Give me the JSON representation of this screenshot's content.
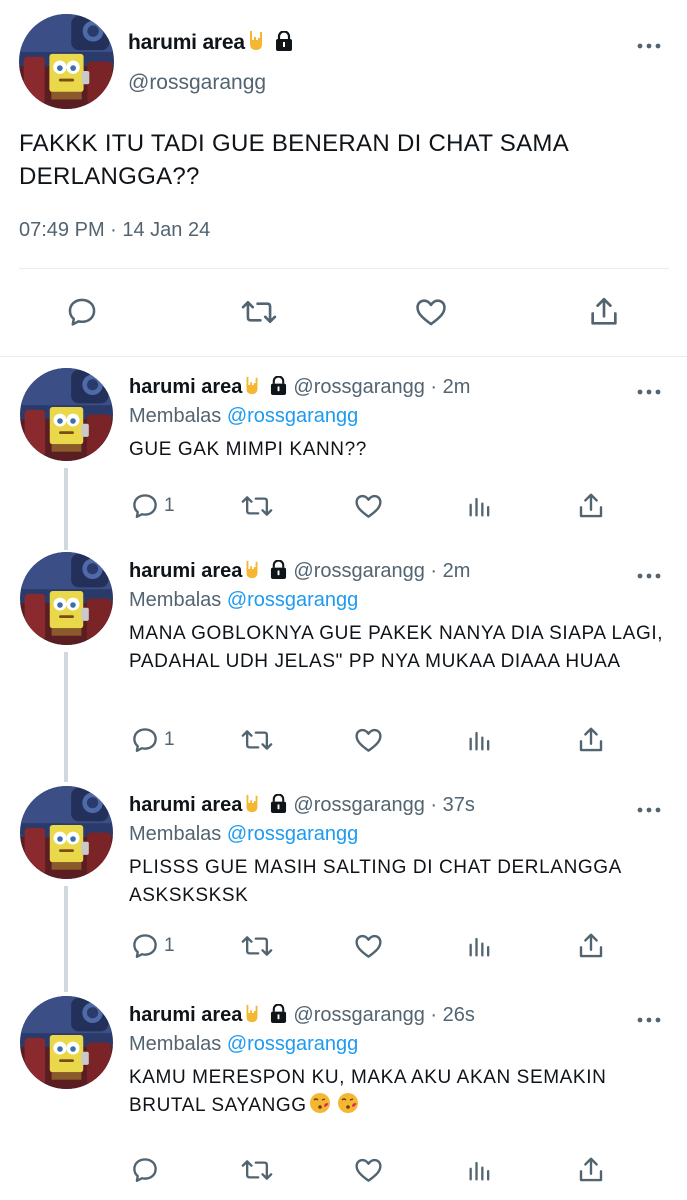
{
  "main_tweet": {
    "name": "harumi area",
    "name_emoji": "🤟",
    "handle": "@rossgarangg",
    "text": "FAKKK ITU TADI GUE BENERAN DI CHAT SAMA DERLANGGA??",
    "timestamp": "07:49 PM · 14 Jan 24",
    "actions": [
      "reply-icon",
      "retweet-icon",
      "like-icon",
      "share-icon"
    ]
  },
  "replies": [
    {
      "name": "harumi area",
      "handle": "@rossgarangg",
      "dot": " · ",
      "time": "2m",
      "replying_prefix": "Membalas ",
      "replying_to": "@rossgarangg",
      "text": "GUE GAK MIMPI KANN??",
      "reply_count": "1"
    },
    {
      "name": "harumi area",
      "handle": "@rossgarangg",
      "dot": " · ",
      "time": "2m",
      "replying_prefix": "Membalas ",
      "replying_to": "@rossgarangg",
      "text": "MANA GOBLOKNYA GUE PAKEK NANYA DIA SIAPA LAGI, PADAHAL UDH JELAS\" PP NYA MUKAA DIAAA HUAA",
      "reply_count": "1"
    },
    {
      "name": "harumi area",
      "handle": "@rossgarangg",
      "dot": " · ",
      "time": "37s",
      "replying_prefix": "Membalas ",
      "replying_to": "@rossgarangg",
      "text": "PLISSS GUE MASIH SALTING DI CHAT DERLANGGA ASKSKSKSK",
      "reply_count": "1"
    },
    {
      "name": "harumi area",
      "handle": "@rossgarangg",
      "dot": " · ",
      "time": "26s",
      "replying_prefix": "Membalas ",
      "replying_to": "@rossgarangg",
      "text": "KAMU MERESPON KU, MAKA AKU AKAN SEMAKIN BRUTAL SAYANGG",
      "reply_count": ""
    }
  ],
  "colors": {
    "text": "#0f1419",
    "secondary": "#536471",
    "link": "#1d9bf0",
    "divider": "#e6ecf0",
    "thread_line": "#cfd9de"
  }
}
